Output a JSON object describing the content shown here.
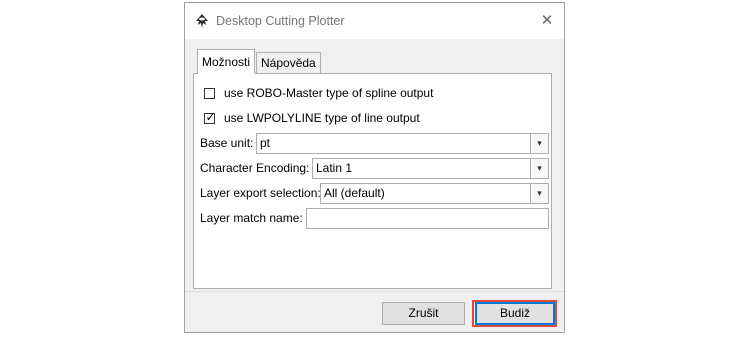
{
  "window": {
    "title": "Desktop Cutting Plotter",
    "close_glyph": "✕"
  },
  "tabs": [
    {
      "label": "Možnosti",
      "active": true
    },
    {
      "label": "Nápověda",
      "active": false
    }
  ],
  "options": {
    "checkbox_robo": {
      "label": "use ROBO-Master type of spline output",
      "checked": false
    },
    "checkbox_lwpoly": {
      "label": "use LWPOLYLINE type of line output",
      "checked": true,
      "check_glyph": "✓"
    },
    "base_unit": {
      "label": "Base unit:",
      "value": "pt"
    },
    "character_encoding": {
      "label": "Character Encoding:",
      "value": "Latin 1"
    },
    "layer_export": {
      "label": "Layer export selection:",
      "value": "All (default)"
    },
    "layer_match": {
      "label": "Layer match name:",
      "value": ""
    },
    "dropdown_glyph": "▾"
  },
  "buttons": {
    "cancel": "Zrušit",
    "ok": "Budiž"
  },
  "colors": {
    "highlight": "#e04a3f",
    "default_button_border": "#0078d7"
  }
}
